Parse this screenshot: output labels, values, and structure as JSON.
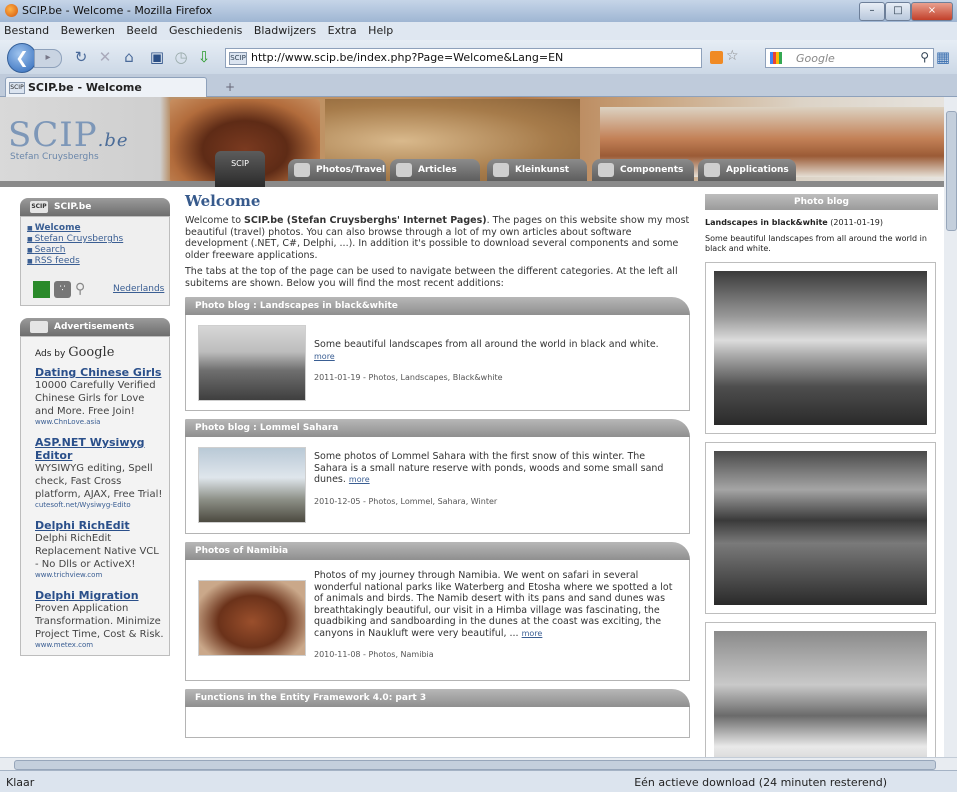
{
  "window": {
    "title": "SCIP.be - Welcome - Mozilla Firefox",
    "controls": [
      "–",
      "□",
      "×"
    ]
  },
  "menubar": {
    "items": [
      "Bestand",
      "Bewerken",
      "Beeld",
      "Geschiedenis",
      "Bladwijzers",
      "Extra",
      "Help"
    ]
  },
  "navbar": {
    "url": "http://www.scip.be/index.php?Page=Welcome&Lang=EN",
    "search_placeholder": "Google"
  },
  "tabs": {
    "active_tab": "SCIP.be - Welcome",
    "new_tab": "+"
  },
  "site": {
    "logo_main": "SCIP",
    "logo_be": ".be",
    "logo_sub": "Stefan Cruysberghs",
    "scip_button": "SCIP",
    "nav": [
      "Photos/Travel",
      "Articles",
      "Kleinkunst",
      "Components",
      "Applications"
    ]
  },
  "left": {
    "box_title": "SCIP.be",
    "links": [
      "Welcome",
      "Stefan Cruysberghs",
      "Search",
      "RSS feeds"
    ],
    "language_link": "Nederlands",
    "ads_title": "Advertisements",
    "ads_by": "Ads by",
    "ads_google": "Google",
    "ads": [
      {
        "title": "Dating Chinese Girls",
        "body": "10000 Carefully Verified Chinese Girls for Love and More. Free Join!",
        "url": "www.ChnLove.asia"
      },
      {
        "title": "ASP.NET Wysiwyg Editor",
        "body": "WYSIWYG editing, Spell check, Fast Cross platform, AJAX, Free Trial!",
        "url": "cutesoft.net/Wysiwyg-Edito"
      },
      {
        "title": "Delphi RichEdit",
        "body": "Delphi RichEdit Replacement Native VCL - No Dlls or ActiveX!",
        "url": "www.trichview.com"
      },
      {
        "title": "Delphi Migration",
        "body": "Proven Application Transformation. Minimize Project Time, Cost & Risk.",
        "url": "www.metex.com"
      }
    ]
  },
  "center": {
    "heading": "Welcome",
    "intro1_pre": "Welcome to ",
    "intro1_bold": "SCIP.be (Stefan Cruysberghs' Internet Pages)",
    "intro1_post": ". The pages on this website show my most beautiful (travel) photos. You can also browse through a lot of my own articles about software development (.NET, C#, Delphi, ...). In addition it's possible to download several components and some older freeware applications.",
    "intro2": "The tabs at the top of the page can be used to navigate between the different categories. At the left all subitems are shown. Below you will find the most recent additions:",
    "cards": [
      {
        "title": "Photo blog : Landscapes in black&white",
        "text": "Some beautiful landscapes from all around the world in black and white.",
        "more": "more",
        "meta": "2011-01-19 - Photos, Landscapes, Black&white"
      },
      {
        "title": "Photo blog : Lommel Sahara",
        "text": "Some photos of Lommel Sahara with the first snow of this winter. The Sahara is a small nature reserve with ponds, woods and some small sand dunes.",
        "more": "more",
        "meta": "2010-12-05 - Photos, Lommel, Sahara, Winter"
      },
      {
        "title": "Photos of Namibia",
        "text": "Photos of my journey through Namibia. We went on safari in several wonderful national parks like Waterberg and Etosha where we spotted a lot of animals and birds. The Namib desert with its pans and sand dunes was breathtakingly beautiful, our visit in a Himba village was fascinating, the quadbiking and sandboarding in the dunes at the coast was exciting, the canyons in Naukluft were very beautiful, ...",
        "more": "more",
        "meta": "2010-11-08 - Photos, Namibia"
      },
      {
        "title": "Functions in the Entity Framework 4.0: part 3"
      }
    ]
  },
  "right": {
    "title": "Photo blog",
    "post_title": "Landscapes in black&white",
    "post_date": "(2011-01-19)",
    "post_desc": "Some beautiful landscapes from all around the world in black and white."
  },
  "status": {
    "left": "Klaar",
    "download": "Eén actieve download (24 minuten resterend)"
  }
}
